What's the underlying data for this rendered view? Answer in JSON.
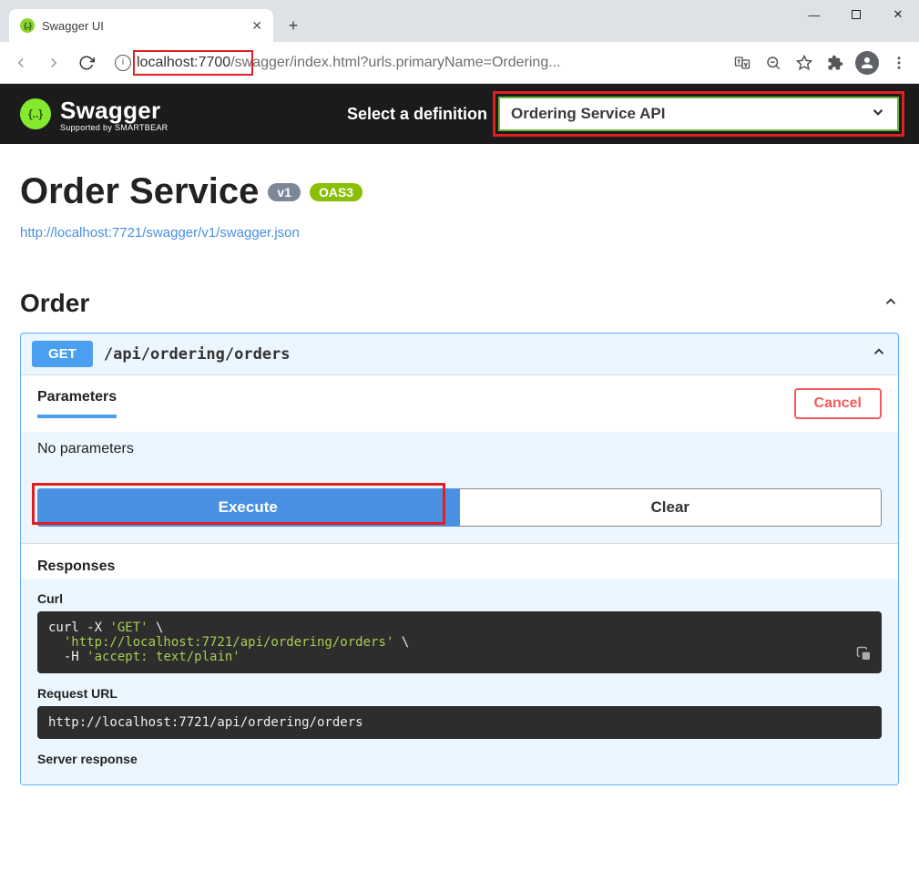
{
  "browser": {
    "tabTitle": "Swagger UI",
    "newTab": "+",
    "url_host": "localhost:7700",
    "url_path": "/swagger/index.html?urls.primaryName=Ordering..."
  },
  "topbar": {
    "logoText": "Swagger",
    "logoSub": "Supported by SMARTBEAR",
    "selectLabel": "Select a definition",
    "selected": "Ordering Service API"
  },
  "api": {
    "title": "Order Service",
    "versionBadge": "v1",
    "oasBadge": "OAS3",
    "jsonLink": "http://localhost:7721/swagger/v1/swagger.json"
  },
  "tag": {
    "name": "Order"
  },
  "op": {
    "method": "GET",
    "path": "/api/ordering/orders",
    "paramsLabel": "Parameters",
    "cancel": "Cancel",
    "noParams": "No parameters",
    "execute": "Execute",
    "clear": "Clear",
    "responsesLabel": "Responses",
    "curlLabel": "Curl",
    "curl_line1_a": "curl -X ",
    "curl_line1_b": "'GET'",
    "curl_line1_c": " \\",
    "curl_line2_a": "  ",
    "curl_line2_b": "'http://localhost:7721/api/ordering/orders'",
    "curl_line2_c": " \\",
    "curl_line3_a": "  -H ",
    "curl_line3_b": "'accept: text/plain'",
    "requestUrlLabel": "Request URL",
    "requestUrl": "http://localhost:7721/api/ordering/orders",
    "serverResponseLabel": "Server response"
  }
}
